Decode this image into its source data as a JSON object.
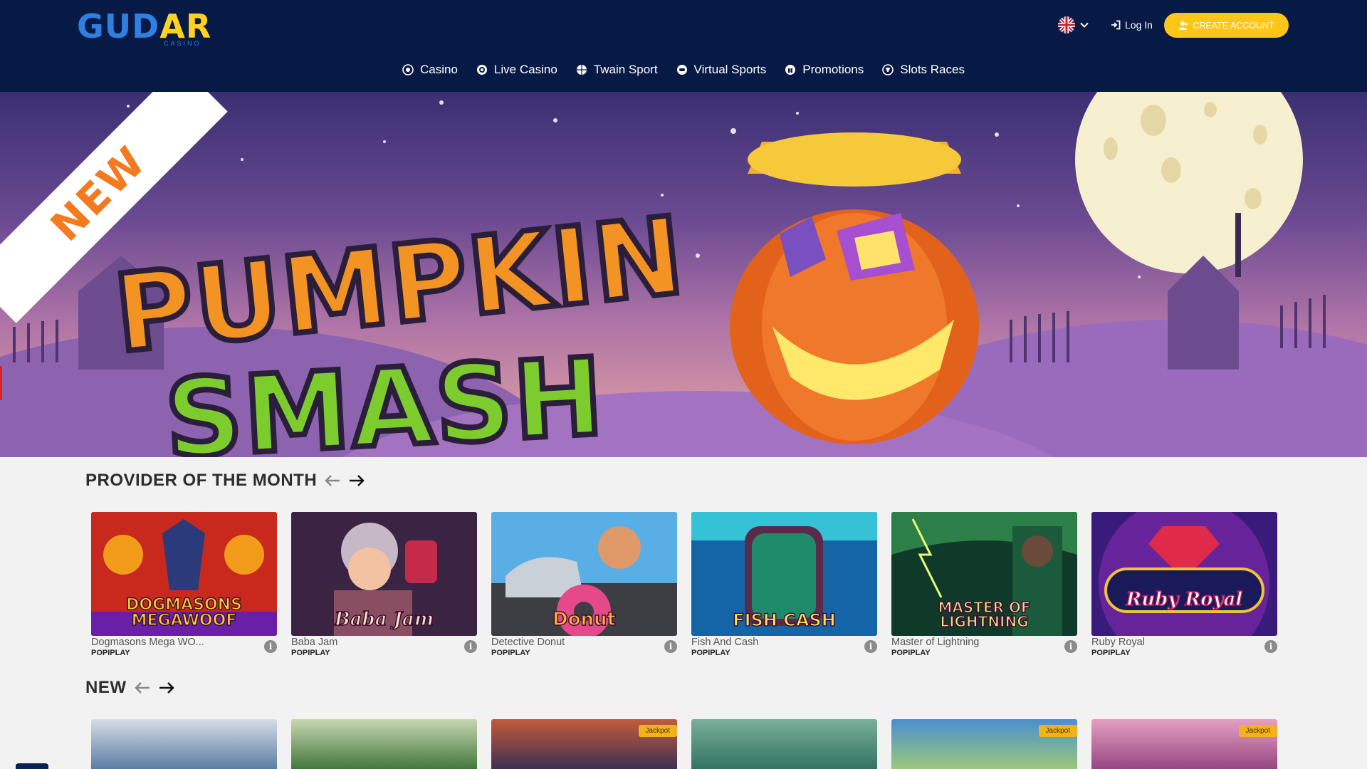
{
  "brand": {
    "logo_part1": "GUD",
    "logo_part2": "AR",
    "logo_sub": "CASINO"
  },
  "header": {
    "language_flag": "uk-flag-icon",
    "login_label": "Log In",
    "create_account_label": "CREATE ACCOUNT",
    "colors": {
      "bg": "#061a45",
      "accent": "#ffc61a"
    }
  },
  "nav": {
    "items": [
      {
        "label": "Casino",
        "icon": "casino-chip-icon"
      },
      {
        "label": "Live Casino",
        "icon": "live-casino-icon"
      },
      {
        "label": "Twain Sport",
        "icon": "sport-ball-icon"
      },
      {
        "label": "Virtual Sports",
        "icon": "gamepad-icon"
      },
      {
        "label": "Promotions",
        "icon": "gift-icon"
      },
      {
        "label": "Slots Races",
        "icon": "trophy-icon"
      }
    ]
  },
  "hero": {
    "ribbon": "NEW",
    "title_line1": "PUMPKIN",
    "title_line2": "SMASH"
  },
  "provider_section": {
    "title": "PROVIDER OF THE MONTH",
    "games": [
      {
        "name": "Dogmasons Mega WO...",
        "provider": "POPIPLAY",
        "art_label": "DOGMASONS MEGAWOOF",
        "colors": [
          "#c9281d",
          "#f39b1b"
        ]
      },
      {
        "name": "Baba Jam",
        "provider": "POPIPLAY",
        "art_label": "Baba Jam",
        "colors": [
          "#3b2443",
          "#8a4e62"
        ]
      },
      {
        "name": "Detective Donut",
        "provider": "POPIPLAY",
        "art_label": "Donut",
        "colors": [
          "#3f8fd0",
          "#e6498a"
        ]
      },
      {
        "name": "Fish And Cash",
        "provider": "POPIPLAY",
        "art_label": "FISH CASH",
        "colors": [
          "#1464a8",
          "#36c2d6"
        ]
      },
      {
        "name": "Master of Lightning",
        "provider": "POPIPLAY",
        "art_label": "MASTER OF LIGHTNING",
        "colors": [
          "#0f3a2a",
          "#3fae5a"
        ]
      },
      {
        "name": "Ruby Royal",
        "provider": "POPIPLAY",
        "art_label": "Ruby Royal",
        "colors": [
          "#3a1a7a",
          "#d02b5a"
        ]
      }
    ]
  },
  "new_section": {
    "title": "NEW",
    "games": [
      {
        "jackpot": "",
        "colors": [
          "#4a6f9a",
          "#d8dde6"
        ]
      },
      {
        "jackpot": "",
        "colors": [
          "#2f6a2a",
          "#c9d7b2"
        ]
      },
      {
        "jackpot": "Jackpot",
        "colors": [
          "#2a2a55",
          "#c45b3a"
        ]
      },
      {
        "jackpot": "",
        "colors": [
          "#2a6a5a",
          "#7ab09a"
        ]
      },
      {
        "jackpot": "Jackpot",
        "colors": [
          "#4a8fd0",
          "#a8d070"
        ]
      },
      {
        "jackpot": "Jackpot",
        "colors": [
          "#8a3a7a",
          "#e6a0c0"
        ]
      }
    ]
  }
}
